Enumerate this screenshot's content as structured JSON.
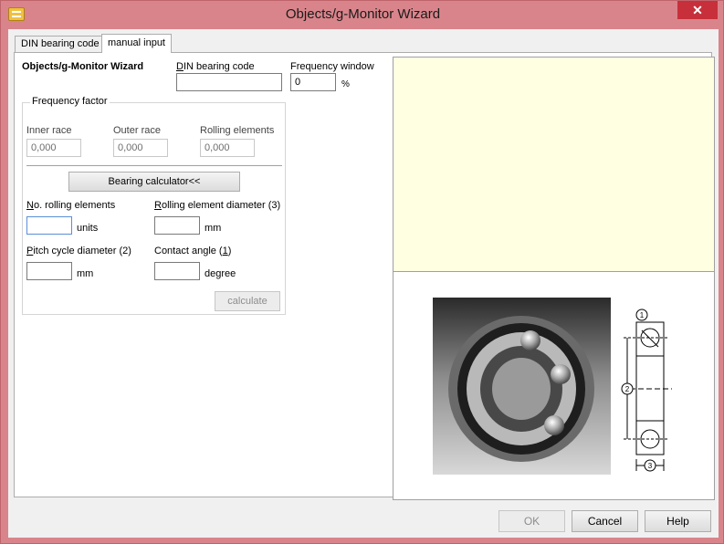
{
  "window": {
    "title": "Objects/g-Monitor Wizard",
    "close_label": "✕"
  },
  "tabs": [
    {
      "label": "DIN bearing code",
      "active": false
    },
    {
      "label": "manual input",
      "active": true
    }
  ],
  "form": {
    "header": "Objects/g-Monitor Wizard",
    "din_label": "DIN bearing code",
    "din_value": "",
    "freq_window_label": "Frequency window",
    "freq_window_value": "0",
    "freq_window_unit": "%"
  },
  "frequency_factor": {
    "title": "Frequency factor",
    "inner_race_label": "Inner race",
    "inner_race_value": "0,000",
    "outer_race_label": "Outer race",
    "outer_race_value": "0,000",
    "rolling_elements_label": "Rolling elements",
    "rolling_elements_value": "0,000",
    "calculator_button": "Bearing calculator<<",
    "no_rolling_label": "No. rolling elements",
    "no_rolling_unit": "units",
    "rolling_diameter_label": "Rolling element diameter (3)",
    "rolling_diameter_unit": "mm",
    "pitch_label": "Pitch cycle diameter (2)",
    "pitch_unit": "mm",
    "contact_label": "Contact angle (1)",
    "contact_unit": "degree",
    "calculate_button": "calculate"
  },
  "diagram_labels": {
    "angle": "1",
    "pitch": "2",
    "width": "3"
  },
  "footer": {
    "ok": "OK",
    "cancel": "Cancel",
    "help": "Help"
  },
  "colors": {
    "frame": "#d9848b",
    "info_panel": "#ffffe1",
    "close_button": "#c7303a"
  }
}
